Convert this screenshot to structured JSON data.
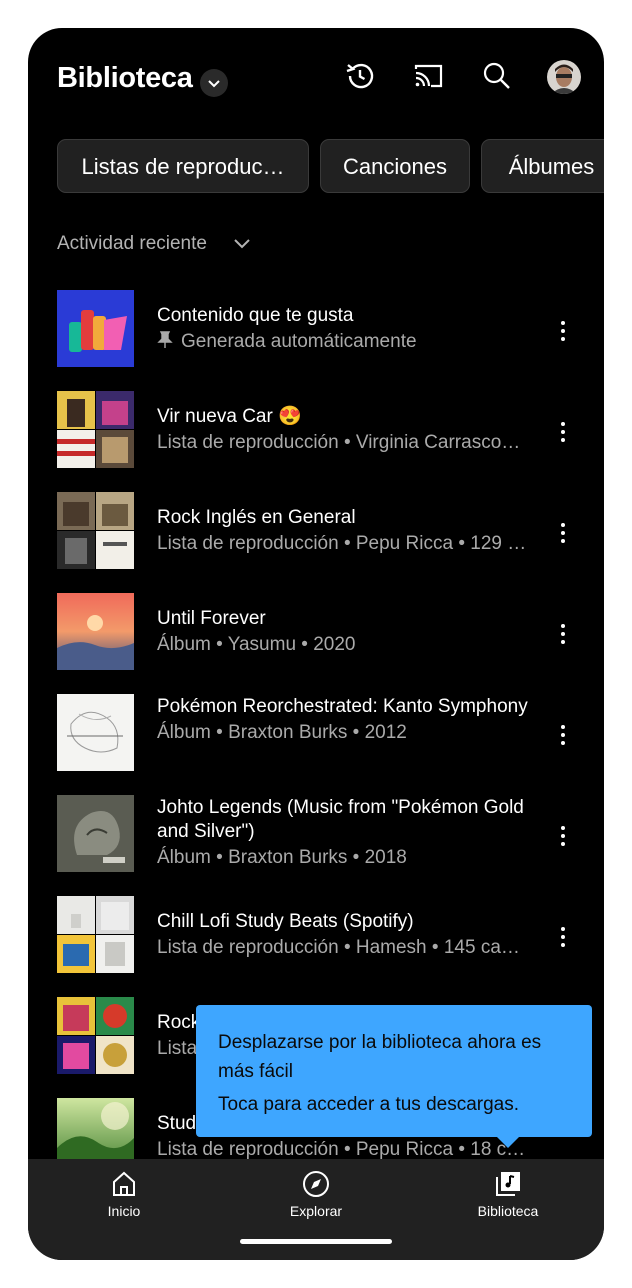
{
  "header": {
    "title": "Biblioteca",
    "icons": [
      "history-icon",
      "cast-icon",
      "search-icon",
      "avatar"
    ]
  },
  "chips": [
    {
      "label": "Listas de reproduc…"
    },
    {
      "label": "Canciones"
    },
    {
      "label": "Álbumes"
    }
  ],
  "recent": {
    "label": "Actividad reciente"
  },
  "items": [
    {
      "title": "Contenido que te gusta",
      "subtitle": "Generada automáticamente",
      "pinned": true
    },
    {
      "title": "Vir nueva Car 😍",
      "subtitle": "Lista de reproducción • Virginia Carrasco…"
    },
    {
      "title": "Rock Inglés en General",
      "subtitle": "Lista de reproducción • Pepu Ricca • 129 …"
    },
    {
      "title": "Until Forever",
      "subtitle": "Álbum • Yasumu • 2020"
    },
    {
      "title": "Pokémon Reorchestrated: Kanto Symphony",
      "subtitle": "Álbum • Braxton Burks • 2012"
    },
    {
      "title": "Johto Legends (Music from \"Pokémon Gold and Silver\")",
      "subtitle": "Álbum • Braxton Burks • 2018"
    },
    {
      "title": "Chill Lofi Study Beats (Spotify)",
      "subtitle": "Lista de reproducción • Hamesh • 145 ca…"
    },
    {
      "title": "Rock",
      "subtitle": "Lista"
    },
    {
      "title": "Stud",
      "subtitle": "Lista de reproducción • Pepu Ricca • 18 c…"
    }
  ],
  "tooltip": {
    "title": "Desplazarse por la biblioteca ahora es más fácil",
    "body": "Toca para acceder a tus descargas."
  },
  "nav": [
    {
      "label": "Inicio",
      "icon": "home-icon"
    },
    {
      "label": "Explorar",
      "icon": "compass-icon"
    },
    {
      "label": "Biblioteca",
      "icon": "library-icon",
      "active": true
    }
  ],
  "colors": {
    "background": "#000000",
    "tooltip": "#3ea6ff",
    "navbar": "#212121"
  }
}
